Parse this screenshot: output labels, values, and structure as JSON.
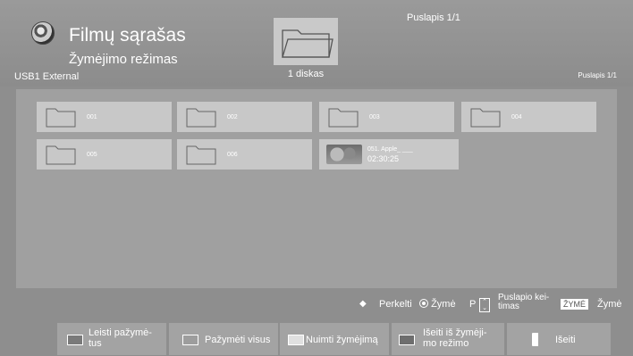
{
  "header": {
    "title": "Filmų sąrašas",
    "mode": "Žymėjimo režimas",
    "device": "USB1 External",
    "disk_label": "1 diskas",
    "page_top": "Puslapis 1/1",
    "page_right": "Puslapis 1/1"
  },
  "tiles": [
    {
      "label": "001",
      "kind": "folder"
    },
    {
      "label": "002",
      "kind": "folder"
    },
    {
      "label": "003",
      "kind": "folder"
    },
    {
      "label": "004",
      "kind": "folder"
    },
    {
      "label": "005",
      "kind": "folder"
    },
    {
      "label": "006",
      "kind": "folder"
    },
    {
      "label": "051. Apple_ ___",
      "sub": "02:30:25",
      "kind": "video"
    }
  ],
  "controls": {
    "move": "Perkelti",
    "mark": "Žymė",
    "p": "P",
    "page_change_1": "Puslapio kei-",
    "page_change_2": "timas",
    "zyme_tag": "ŽYMĖ",
    "zyme": "Žymė"
  },
  "buttons": {
    "play_marked_1": "Leisti pažymė-",
    "play_marked_2": "tus",
    "mark_all": "Pažymėti visus",
    "unmark": "Nuimti žymėjimą",
    "exit_mode_1": "Išeiti iš žymėji-",
    "exit_mode_2": "mo režimo",
    "exit": "Išeiti"
  },
  "colors": {
    "background": "#8e8e8e",
    "tile": "#c8c8c8",
    "grid_area": "#a0a0a0",
    "button": "#a3a3a3",
    "swatch_red": "#7a7a7a",
    "swatch_green": "#9d9d9d",
    "swatch_yellow": "#e0e0e0",
    "swatch_blue": "#6e6e6e"
  }
}
